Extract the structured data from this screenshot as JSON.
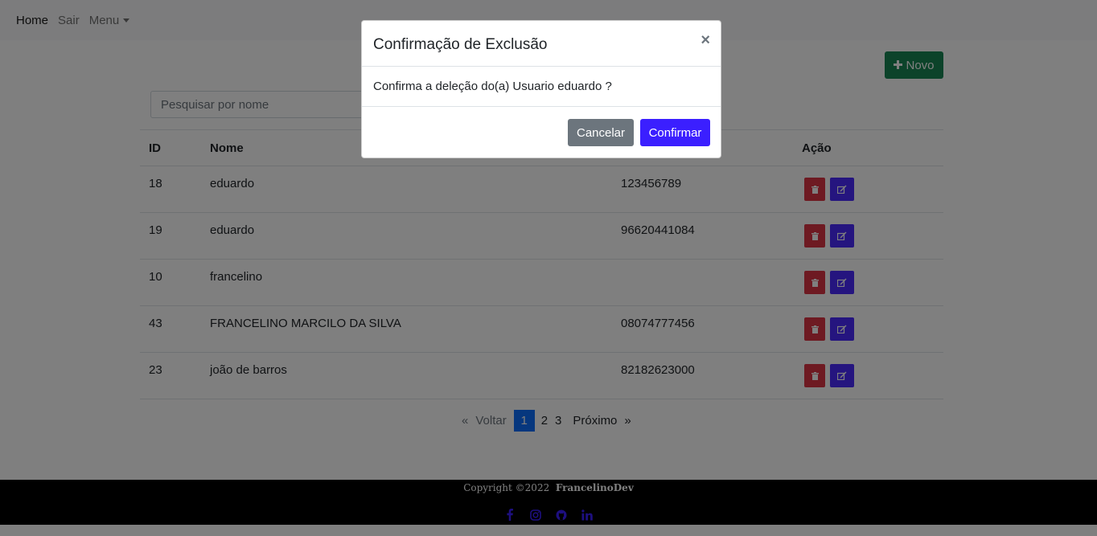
{
  "navbar": {
    "home": "Home",
    "sair": "Sair",
    "menu": "Menu"
  },
  "toolbar": {
    "novo_label": "Novo",
    "search_placeholder": "Pesquisar por nome",
    "novo_icon": "plus-icon"
  },
  "table": {
    "headers": [
      "ID",
      "Nome",
      "",
      "Ação"
    ],
    "rows": [
      {
        "id": "18",
        "nome": "eduardo",
        "telefone": "123456789"
      },
      {
        "id": "19",
        "nome": "eduardo",
        "telefone": "96620441084"
      },
      {
        "id": "10",
        "nome": "francelino",
        "telefone": ""
      },
      {
        "id": "43",
        "nome": "FRANCELINO MARCILO DA SILVA",
        "telefone": "08074777456"
      },
      {
        "id": "23",
        "nome": "joão de barros",
        "telefone": "82182623000"
      }
    ],
    "action_icons": [
      "trash-icon",
      "edit-icon"
    ]
  },
  "pagination": {
    "prev_symbol": "«",
    "prev_label": "Voltar",
    "pages": [
      "1",
      "2",
      "3"
    ],
    "current_page": "1",
    "next_label": "Próximo",
    "next_symbol": "»"
  },
  "footer": {
    "copyright": "Copyright ©2022",
    "brand": "FrancelinoDev",
    "social_icons": [
      "facebook-icon",
      "instagram-icon",
      "github-icon",
      "linkedin-icon"
    ]
  },
  "modal": {
    "title": "Confirmação de Exclusão",
    "close_symbol": "×",
    "message": "Confirma a deleção do(a) Usuario eduardo ?",
    "cancel_label": "Cancelar",
    "confirm_label": "Confirmar"
  },
  "colors": {
    "success": "#198754",
    "danger": "#dc3545",
    "primary_edit": "#4b2bff",
    "confirm": "#3b1fff",
    "cancel": "#6c757d",
    "page_active": "#0d6efd"
  }
}
